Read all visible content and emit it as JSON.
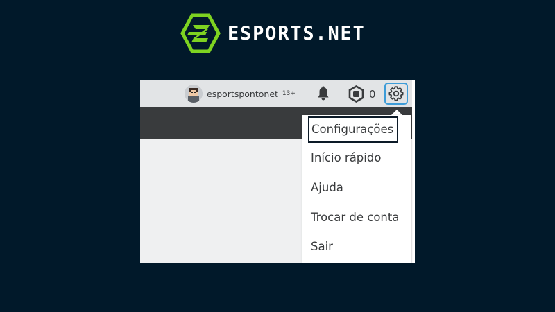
{
  "brand": {
    "name": "ESPORTS.NET",
    "logo_color": "#7ed321",
    "background": "#01192a"
  },
  "topbar": {
    "username": "esportspontonet",
    "age_badge": "13+",
    "notifications_icon": "bell-icon",
    "robux_icon": "robux-icon",
    "robux_count": "0",
    "settings_icon": "gear-icon",
    "settings_focus_color": "#3d9cd8"
  },
  "settings_menu": {
    "items": [
      {
        "label": "Configurações",
        "focused": true
      },
      {
        "label": "Início rápido"
      },
      {
        "label": "Ajuda"
      },
      {
        "label": "Trocar de conta"
      },
      {
        "label": "Sair"
      }
    ]
  }
}
